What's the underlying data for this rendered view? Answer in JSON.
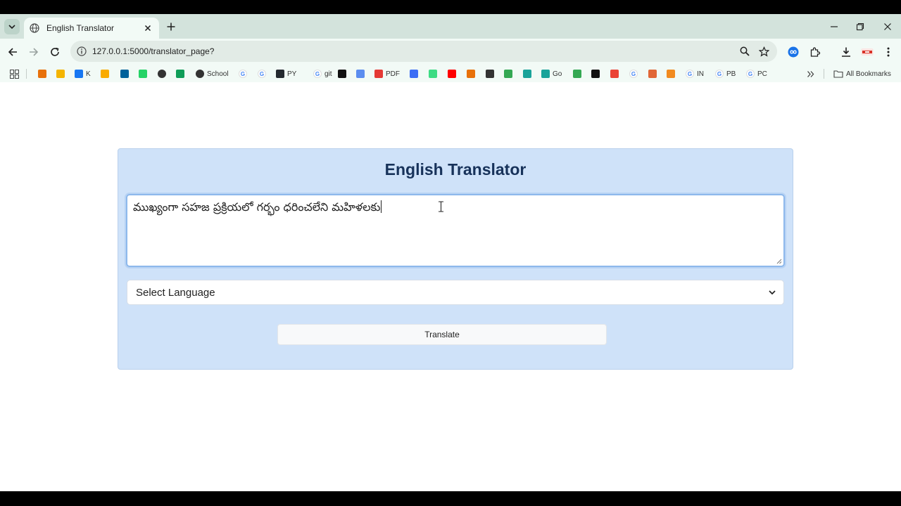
{
  "browser": {
    "tab_title": "English Translator",
    "url": "127.0.0.1:5000/translator_page?",
    "bookmarks": [
      {
        "label": "",
        "icon": "arrow-bookmark-icon",
        "color": "#e8710a"
      },
      {
        "label": "",
        "icon": "yellow-bookmark-icon",
        "color": "#f4b400"
      },
      {
        "label": "K",
        "icon": "facebook-icon",
        "color": "#1877f2"
      },
      {
        "label": "",
        "icon": "bar-chart-bookmark-icon",
        "color": "#f9ab00"
      },
      {
        "label": "",
        "icon": "ieee-icon",
        "color": "#00629b"
      },
      {
        "label": "",
        "icon": "whatsapp-icon",
        "color": "#25d366"
      },
      {
        "label": "",
        "icon": "globe-bookmark-icon",
        "color": "#333333"
      },
      {
        "label": "",
        "icon": "green-plus-bookmark-icon",
        "color": "#0f9d58"
      },
      {
        "label": "School",
        "icon": "globe-school-icon",
        "color": "#333333"
      },
      {
        "label": "",
        "icon": "google-icon",
        "color": "#4285f4"
      },
      {
        "label": "",
        "icon": "google-icon",
        "color": "#4285f4"
      },
      {
        "label": "PY",
        "icon": "github-icon",
        "color": "#24292f"
      },
      {
        "label": "git",
        "icon": "google-icon",
        "color": "#4285f4"
      },
      {
        "label": "",
        "icon": "chatgpt-icon",
        "color": "#111111"
      },
      {
        "label": "",
        "icon": "gear-bookmark-icon",
        "color": "#5b8def"
      },
      {
        "label": "PDF",
        "icon": "pdf-icon",
        "color": "#e53935"
      },
      {
        "label": "",
        "icon": "blue-bookmark-icon",
        "color": "#3b6ef5"
      },
      {
        "label": "",
        "icon": "android-icon",
        "color": "#3ddc84"
      },
      {
        "label": "",
        "icon": "youtube-icon",
        "color": "#ff0000"
      },
      {
        "label": "",
        "icon": "z-bookmark-icon",
        "color": "#e8710a"
      },
      {
        "label": "",
        "icon": "oval-bookmark-icon",
        "color": "#333333"
      },
      {
        "label": "",
        "icon": "green-ring-icon",
        "color": "#34a853"
      },
      {
        "label": "",
        "icon": "teal-swirl-icon",
        "color": "#19a39a"
      },
      {
        "label": "Go",
        "icon": "teal-swirl-icon",
        "color": "#19a39a"
      },
      {
        "label": "",
        "icon": "green-leaf-icon",
        "color": "#34a853"
      },
      {
        "label": "",
        "icon": "cd-bookmark-icon",
        "color": "#111111"
      },
      {
        "label": "",
        "icon": "red-g-bookmark-icon",
        "color": "#ea4335"
      },
      {
        "label": "",
        "icon": "google-icon",
        "color": "#4285f4"
      },
      {
        "label": "",
        "icon": "matlab-icon",
        "color": "#e16737"
      },
      {
        "label": "",
        "icon": "orange-sun-icon",
        "color": "#f28b20"
      },
      {
        "label": "IN",
        "icon": "google-icon",
        "color": "#4285f4"
      },
      {
        "label": "PB",
        "icon": "google-icon",
        "color": "#4285f4"
      },
      {
        "label": "PC",
        "icon": "google-icon",
        "color": "#4285f4"
      }
    ],
    "all_bookmarks_label": "All Bookmarks"
  },
  "page": {
    "title": "English Translator",
    "input_text": "ముఖ్యంగా సహజ ప్రక్రియలో గర్భం ధరించలేని మహిళలకు",
    "select_value": "Select Language",
    "translate_label": "Translate"
  },
  "colors": {
    "card_bg": "#cfe2f9",
    "title_color": "#17325a",
    "focus_border": "#8db8ec"
  }
}
